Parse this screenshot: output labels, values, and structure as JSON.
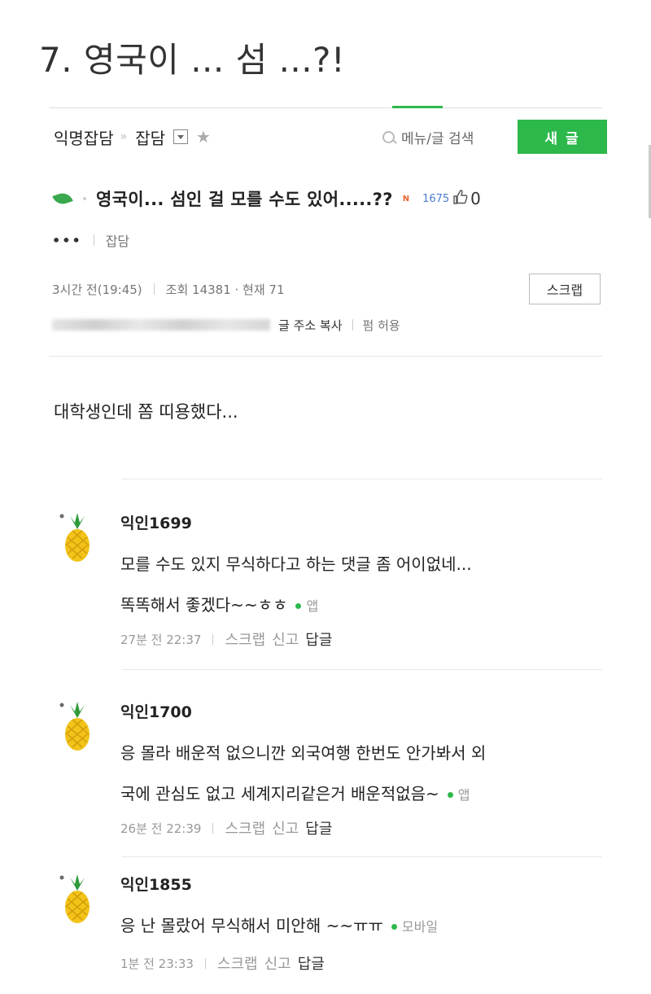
{
  "caption": "7. 영국이 ... 섬 ...?!",
  "header": {
    "board": "익명잡담",
    "separator": "»",
    "sub_board": "잡담",
    "star": "★",
    "search_label": "메뉴/글 검색",
    "write_button": "새 글"
  },
  "post": {
    "title": "영국이... 섬인 걸 모를 수도 있어.....??",
    "new_badge": "N",
    "views_small": "1675",
    "like_count": "0",
    "author": "•••",
    "category": "잡담",
    "time": "3시간 전(19:45)",
    "views": "조회 14381 · 현재 71",
    "scrap_button": "스크랩",
    "copy_url": "글 주소 복사",
    "permission": "펌 허용",
    "body": "대학생인데 쫌 띠용했다..."
  },
  "comments": [
    {
      "name": "익인1699",
      "lines": [
        "모를 수도 있지 무식하다고 하는 댓글 좀 어이없네...",
        "똑똑해서 좋겠다~~ㅎㅎ"
      ],
      "device": "앱",
      "time": "27분 전 22:37",
      "scrap": "스크랩",
      "report": "신고",
      "reply": "답글"
    },
    {
      "name": "익인1700",
      "lines": [
        "응 몰라 배운적 없으니깐 외국여행 한번도 안가봐서 외",
        "국에 관심도 없고 세계지리같은거 배운적없음~"
      ],
      "device": "앱",
      "time": "26분 전 22:39",
      "scrap": "스크랩",
      "report": "신고",
      "reply": "답글"
    },
    {
      "name": "익인1855",
      "lines": [
        "응 난 몰랐어 무식해서 미안해 ~~ㅠㅠ"
      ],
      "device": "모바일",
      "time": "1분 전 23:33",
      "scrap": "스크랩",
      "report": "신고",
      "reply": "답글"
    }
  ],
  "colors": {
    "accent_green": "#2db84c",
    "new_badge": "#e8632c",
    "views_blue": "#4a7bd0"
  },
  "icons": [
    "search-icon",
    "dropdown-icon",
    "star-icon",
    "leaf-icon",
    "thumbs-up-icon",
    "pineapple-avatar-icon",
    "app-dot-icon"
  ]
}
